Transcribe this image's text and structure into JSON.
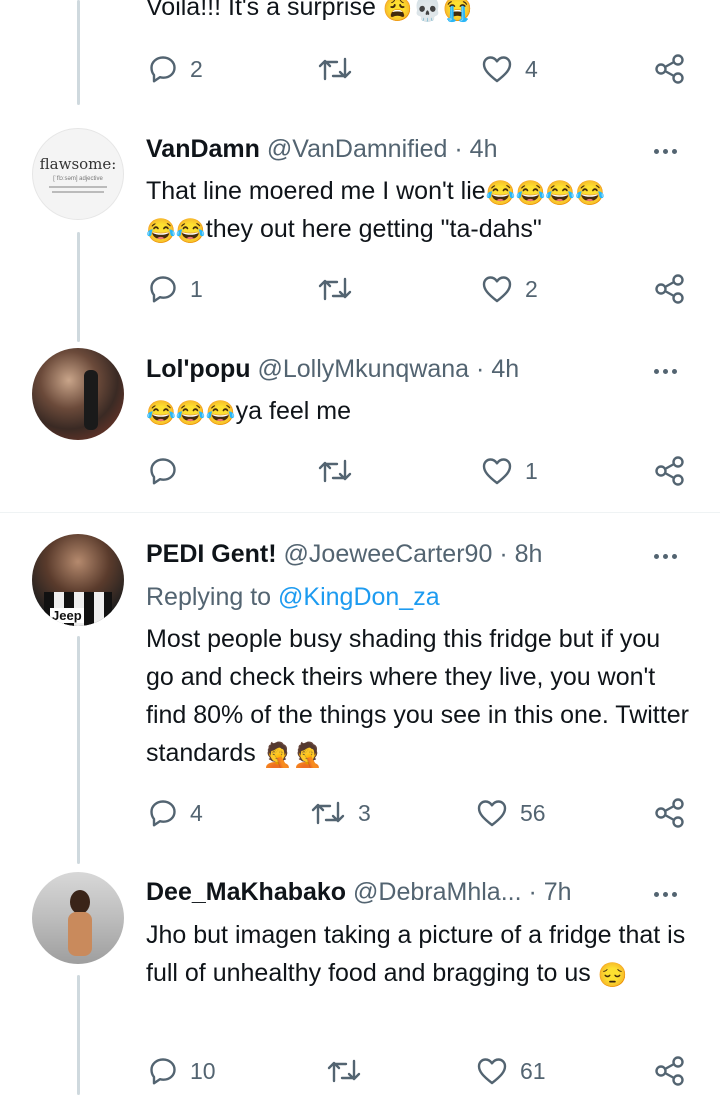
{
  "tweets": [
    {
      "body": "Voila!!! It's a surprise",
      "emojis": "😩💀😭",
      "replies": "2",
      "retweets": "",
      "likes": "4"
    },
    {
      "name": "VanDamn",
      "handle": "@VanDamnified",
      "time": "· 4h",
      "avatar_text": "flawsome:",
      "avatar_sub": "[ˈflɔːsəm] adjective",
      "body_line1": "That line moered me I won't lie",
      "body_line1_emojis": "😂😂😂😂",
      "body_line2_emojis": "😂😂",
      "body_line2": "they out here getting \"ta-dahs\"",
      "replies": "1",
      "retweets": "",
      "likes": "2"
    },
    {
      "name": "Lol'popu",
      "handle": "@LollyMkunqwana",
      "time": "· 4h",
      "body_emojis": "😂😂😂",
      "body": "ya feel me",
      "replies": "",
      "retweets": "",
      "likes": "1"
    },
    {
      "name": "PEDI Gent!",
      "handle": "@JoeweeCarter90",
      "time": "· 8h",
      "avatar_text": "Jeep",
      "replying_to": "Replying to",
      "mention": "@KingDon_za",
      "body": "Most people busy shading this fridge but if you go and check theirs where they live, you won't find 80% of the things you see in this one. Twitter standards",
      "emojis": "🤦🤦",
      "replies": "4",
      "retweets": "3",
      "likes": "56"
    },
    {
      "name": "Dee_MaKhabako",
      "handle": "@DebraMhla...",
      "time": "· 7h",
      "body": "Jho but imagen taking a picture of a fridge that is full of unhealthy food and bragging to us",
      "emojis": "😔",
      "replies": "10",
      "retweets": "",
      "likes": "61"
    }
  ],
  "colors": {
    "text": "#0f1419",
    "secondary": "#536471",
    "link": "#1d9bf0",
    "thread_line": "#cfd9de"
  },
  "icons": [
    "reply-icon",
    "retweet-icon",
    "like-icon",
    "share-icon",
    "more-icon"
  ]
}
